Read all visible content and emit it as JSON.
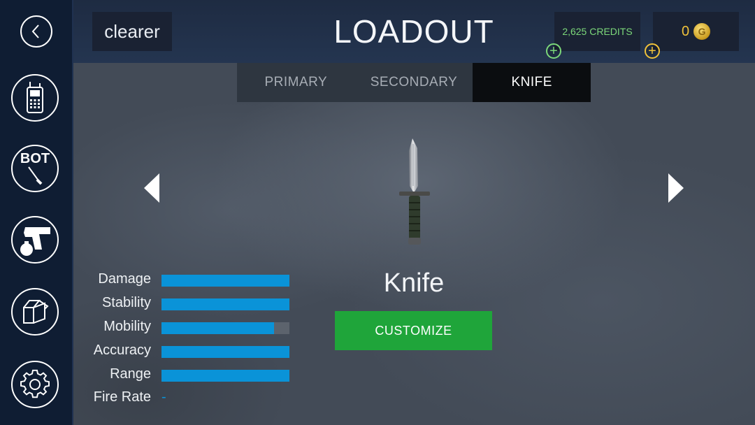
{
  "header": {
    "player_name": "clearer",
    "title": "LOADOUT",
    "credits": "2,625 CREDITS",
    "gold": "0",
    "coin_symbol": "G"
  },
  "sidebar": {
    "items": [
      {
        "id": "back",
        "icon": "back-arrow-icon"
      },
      {
        "id": "radio",
        "icon": "radio-icon"
      },
      {
        "id": "bot",
        "icon": "bot-knife-icon",
        "label": "BOT"
      },
      {
        "id": "weapons",
        "icon": "pistol-grenade-icon"
      },
      {
        "id": "crates",
        "icon": "crate-icon"
      },
      {
        "id": "settings",
        "icon": "gear-icon"
      }
    ]
  },
  "tabs": [
    {
      "label": "PRIMARY",
      "active": false
    },
    {
      "label": "SECONDARY",
      "active": false
    },
    {
      "label": "KNIFE",
      "active": true
    }
  ],
  "weapon": {
    "name": "Knife",
    "customize_label": "CUSTOMIZE"
  },
  "stats": [
    {
      "label": "Damage",
      "value": 1.0
    },
    {
      "label": "Stability",
      "value": 1.0
    },
    {
      "label": "Mobility",
      "value": 0.88
    },
    {
      "label": "Accuracy",
      "value": 1.0
    },
    {
      "label": "Range",
      "value": 1.0
    },
    {
      "label": "Fire Rate",
      "value": null,
      "display": "-"
    }
  ],
  "colors": {
    "accent_blue": "#0a93d8",
    "customize_green": "#1fa53a",
    "credits_green": "#7cd87a",
    "gold_yellow": "#f0c23a"
  }
}
